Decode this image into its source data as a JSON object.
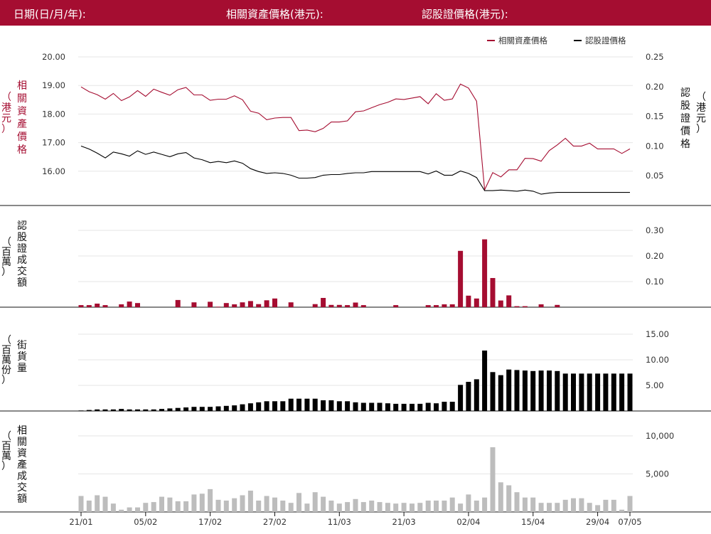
{
  "header": {
    "date_label": "日期(日/月/年):",
    "underlying_label": "相關資產價格(港元):",
    "warrant_label": "認股證價格(港元):"
  },
  "colors": {
    "brand": "#a50d31",
    "underlying": "#a50d31",
    "warrant": "#000000",
    "turnover_bar": "#a50d31",
    "outstanding_bar": "#000000",
    "underlying_turnover_bar": "#bdbdbd"
  },
  "chart_data": [
    {
      "type": "line",
      "title": "",
      "legend": [
        "相關資產價格",
        "認股證價格"
      ],
      "legend_position": "top-right",
      "left_axis_label": [
        "相",
        "關",
        "資",
        "產",
        "價",
        "格"
      ],
      "left_axis_unit": [
        "（",
        "港",
        "元",
        "）"
      ],
      "right_axis_label": [
        "認",
        "股",
        "證",
        "價",
        "格"
      ],
      "right_axis_unit": [
        "（",
        "港",
        "元",
        "）"
      ],
      "left_ticks": [
        "20.00",
        "19.00",
        "18.00",
        "17.00",
        "16.00"
      ],
      "left_ylim": [
        14.8,
        20.0
      ],
      "right_ticks": [
        "0.25",
        "0.20",
        "0.15",
        "0.10",
        "0.05"
      ],
      "right_ylim": [
        0.0,
        0.25
      ],
      "series": [
        {
          "name": "相關資產價格",
          "axis": "left",
          "values": [
            18.95,
            18.78,
            18.68,
            18.52,
            18.72,
            18.47,
            18.6,
            18.82,
            18.62,
            18.87,
            18.76,
            18.66,
            18.85,
            18.93,
            18.67,
            18.67,
            18.48,
            18.52,
            18.52,
            18.64,
            18.5,
            18.1,
            18.03,
            17.8,
            17.86,
            17.88,
            17.88,
            17.42,
            17.44,
            17.38,
            17.5,
            17.72,
            17.72,
            17.76,
            18.08,
            18.11,
            18.22,
            18.33,
            18.41,
            18.53,
            18.51,
            18.56,
            18.61,
            18.36,
            18.71,
            18.48,
            18.53,
            19.05,
            18.91,
            18.45,
            15.35,
            15.95,
            15.8,
            16.05,
            16.05,
            16.45,
            16.44,
            16.35,
            16.72,
            16.92,
            17.15,
            16.88,
            16.88,
            16.98,
            16.78,
            16.78,
            16.78,
            16.62,
            16.78
          ]
        },
        {
          "name": "認股證價格",
          "axis": "right",
          "values": [
            0.1,
            0.095,
            0.088,
            0.08,
            0.09,
            0.087,
            0.083,
            0.092,
            0.086,
            0.09,
            0.086,
            0.082,
            0.087,
            0.089,
            0.08,
            0.077,
            0.072,
            0.074,
            0.072,
            0.075,
            0.071,
            0.062,
            0.057,
            0.054,
            0.055,
            0.054,
            0.051,
            0.046,
            0.046,
            0.047,
            0.051,
            0.052,
            0.052,
            0.054,
            0.055,
            0.055,
            0.057,
            0.057,
            0.057,
            0.057,
            0.057,
            0.057,
            0.057,
            0.053,
            0.058,
            0.051,
            0.051,
            0.058,
            0.054,
            0.047,
            0.025,
            0.025,
            0.026,
            0.025,
            0.024,
            0.026,
            0.024,
            0.019,
            0.021,
            0.022,
            0.022,
            0.022,
            0.022,
            0.022,
            0.022,
            0.022,
            0.022,
            0.022,
            0.022
          ]
        }
      ]
    },
    {
      "type": "bar",
      "axis_label": [
        "認",
        "股",
        "證",
        "成",
        "交",
        "額"
      ],
      "axis_unit": [
        "（",
        "百",
        "萬",
        "）"
      ],
      "ticks": [
        "0.30",
        "0.20",
        "0.10"
      ],
      "ylim": [
        0,
        0.3
      ],
      "values": [
        0.008,
        0.008,
        0.014,
        0.008,
        0,
        0.011,
        0.022,
        0.016,
        0,
        0,
        0,
        0,
        0.028,
        0,
        0.019,
        0,
        0.021,
        0.002,
        0.016,
        0.011,
        0.019,
        0.024,
        0.012,
        0.027,
        0.034,
        0,
        0.019,
        0,
        0,
        0.012,
        0.036,
        0.009,
        0.009,
        0.008,
        0.018,
        0.008,
        0,
        0,
        0,
        0.008,
        0,
        0,
        0,
        0.008,
        0.008,
        0.011,
        0.011,
        0.22,
        0.045,
        0.034,
        0.265,
        0.114,
        0.026,
        0.046,
        0.004,
        0.004,
        0,
        0.011,
        0,
        0.009,
        0,
        0,
        0,
        0,
        0,
        0,
        0,
        0,
        0
      ]
    },
    {
      "type": "bar",
      "axis_label": [
        "街",
        "貨",
        "量"
      ],
      "axis_unit": [
        "（",
        "百",
        "萬",
        "份",
        "）"
      ],
      "ticks": [
        "15.00",
        "10.00",
        "5.00"
      ],
      "ylim": [
        0,
        15
      ],
      "values": [
        0.1,
        0.2,
        0.3,
        0.3,
        0.3,
        0.4,
        0.3,
        0.3,
        0.3,
        0.3,
        0.4,
        0.5,
        0.6,
        0.7,
        0.8,
        0.8,
        0.8,
        0.9,
        1,
        1.1,
        1.3,
        1.5,
        1.7,
        1.9,
        1.9,
        1.9,
        2.4,
        2.4,
        2.4,
        2.4,
        2.1,
        2.1,
        1.9,
        1.9,
        1.7,
        1.6,
        1.6,
        1.6,
        1.5,
        1.4,
        1.4,
        1.4,
        1.4,
        1.6,
        1.5,
        1.8,
        1.8,
        5.1,
        5.7,
        6.2,
        11.8,
        7.6,
        7,
        8.1,
        8,
        7.9,
        7.8,
        7.9,
        7.9,
        7.8,
        7.3,
        7.3,
        7.3,
        7.3,
        7.3,
        7.3,
        7.3,
        7.3,
        7.3
      ]
    },
    {
      "type": "bar",
      "axis_label": [
        "相",
        "關",
        "資",
        "產",
        "成",
        "交",
        "額"
      ],
      "axis_unit": [
        "（",
        "百",
        "萬",
        "）"
      ],
      "ticks": [
        "10,000",
        "5,000"
      ],
      "ylim": [
        0,
        10000
      ],
      "values": [
        2100,
        1500,
        2200,
        2000,
        1100,
        300,
        600,
        600,
        1200,
        1300,
        2000,
        1900,
        1400,
        1400,
        2300,
        2400,
        3000,
        1600,
        1500,
        1800,
        2200,
        2800,
        1500,
        2100,
        1900,
        1500,
        1200,
        2500,
        1100,
        2600,
        2000,
        1500,
        1100,
        1300,
        1700,
        1300,
        1500,
        1300,
        1200,
        1100,
        1200,
        1100,
        1200,
        1500,
        1500,
        1500,
        1900,
        1100,
        2300,
        1500,
        1900,
        8500,
        3900,
        3500,
        2600,
        1900,
        1900,
        1200,
        1200,
        1200,
        1600,
        1800,
        1800,
        1200,
        900,
        1600,
        1600,
        300,
        2100
      ]
    }
  ],
  "x_axis": {
    "tick_labels": [
      "21/01",
      "05/02",
      "17/02",
      "27/02",
      "11/03",
      "21/03",
      "02/04",
      "15/04",
      "29/04",
      "07/05"
    ],
    "tick_index": [
      0,
      8,
      16,
      24,
      32,
      40,
      48,
      56,
      64,
      68
    ]
  }
}
